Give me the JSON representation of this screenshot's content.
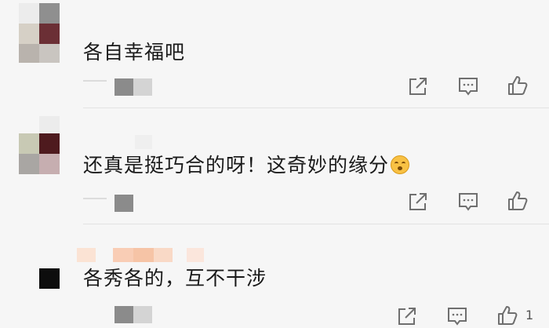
{
  "comments": [
    {
      "text": "各自幸福吧",
      "avatar_colors": [
        "#d6d0c6",
        "#6b2f35",
        "#b9b3ad",
        "#c9c5c0"
      ],
      "actions": [
        "share-icon",
        "reply-icon",
        "like-icon"
      ]
    },
    {
      "text": "还真是挺巧合的呀！这奇妙的缘分",
      "emoji": "surprised-face-emoji",
      "avatar_colors": [
        "#c8c9b4",
        "#4e1a1e",
        "#a9a6a3",
        "#c6aeb0"
      ],
      "actions": [
        "share-icon",
        "reply-icon",
        "like-icon"
      ]
    },
    {
      "text": "各秀各的，互不干涉",
      "like_count": "1",
      "actions": [
        "share-icon",
        "reply-icon",
        "like-icon"
      ]
    }
  ],
  "colors": {
    "background": "#f6f6f6",
    "icon": "#6f6f6f",
    "text": "#1a1a1a"
  }
}
